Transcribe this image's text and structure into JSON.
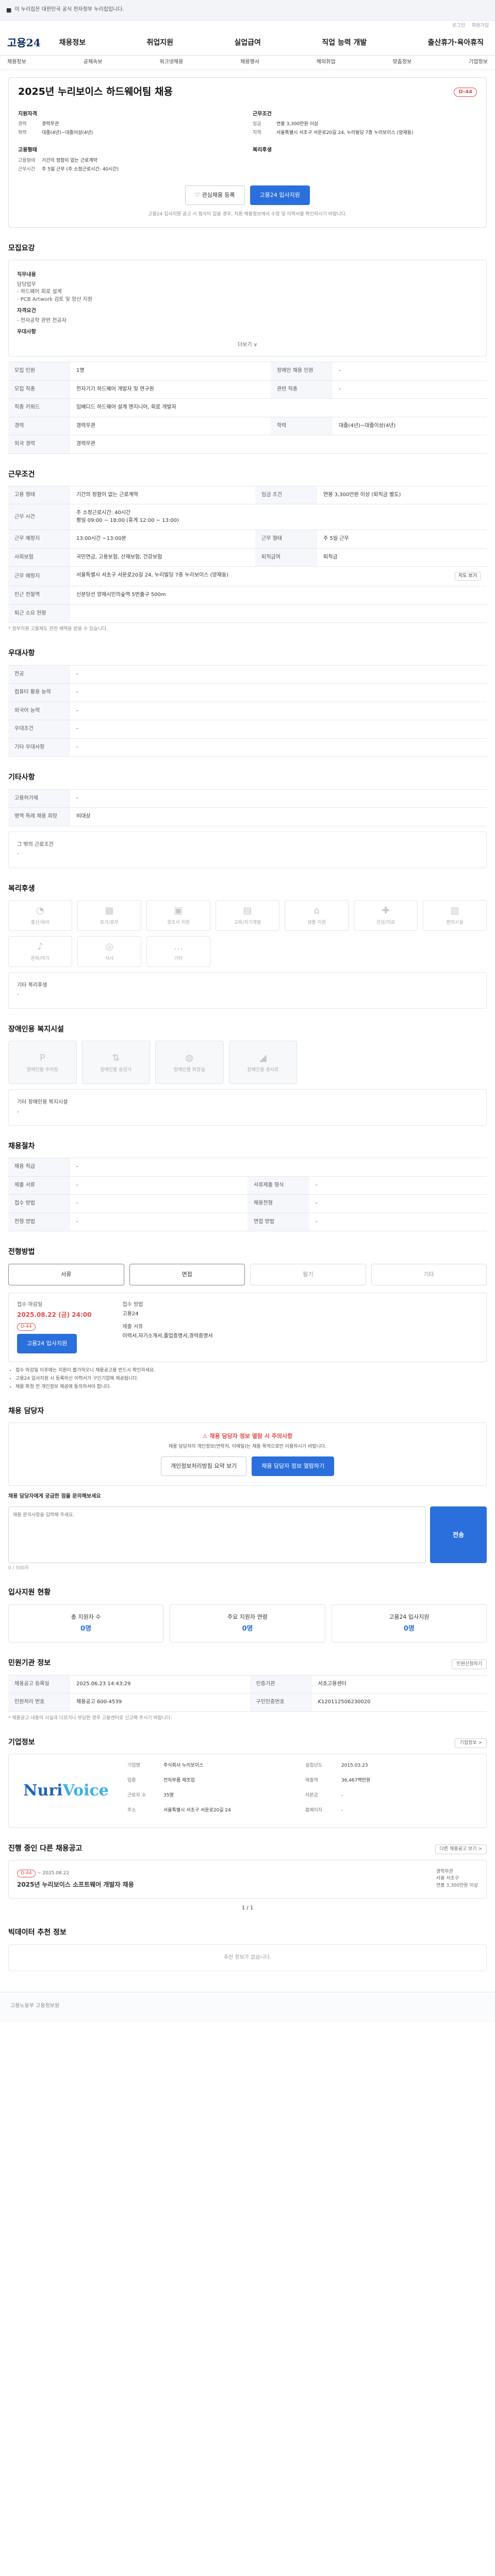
{
  "topbar": {
    "notice": "이 누리집은 대한민국 공식 전자정부 누리집입니다."
  },
  "skip": {
    "a": "로그인",
    "b": "회원가입"
  },
  "header": {
    "logo": "고용24",
    "nav": [
      "채용정보",
      "취업지원",
      "실업급여",
      "직업 능력 개발",
      "출산휴가·육아휴직"
    ]
  },
  "subnav": [
    "채용정보",
    "공채속보",
    "워크넷채용",
    "채용행사",
    "해외취업",
    "맞춤정보",
    "기업정보"
  ],
  "headline": {
    "title": "2025년 누리보이스 하드웨어팀 채용",
    "dday": "D-44",
    "company_h": "지원자격",
    "career_k": "경력",
    "career_v": "경력무관",
    "edu_k": "학력",
    "edu_v": "대졸(4년)~대졸이상(4년)",
    "cond_h": "근무조건",
    "pay_k": "임금",
    "pay_v": "연봉 3,300만원 이상",
    "region_k": "지역",
    "region_v": "서울특별시 서초구 서운로20길 24, 누리빌딩 7층 누리보이스 (양재동)",
    "type_h": "고용형태",
    "type_k": "고용형태",
    "type_v": "기간의 정함이 없는 근로계약",
    "time_k": "근무시간",
    "time_v": "주 5일 근무 (주 소정근로시간: 40시간)",
    "welfare_h": "복리후생",
    "scrap_btn": "관심채용 등록",
    "apply_btn": "고용24 입사지원",
    "note": "고용24 입사지원 공고 시 첨삭이 없을 경우, 지원 채용정보에서 수정 및 이력서를 확인하시기 바랍니다."
  },
  "detail": {
    "title": "모집요강",
    "job_label": "직무내용",
    "job_text": "담당업무\n- 하드웨어 회로 설계\n- PCB Artwork 검토 및 양산 지원",
    "req_label": "자격요건",
    "req_text": "- 전자공학 관련 전공자",
    "pref_label": "우대사항",
    "more": "더보기 ∨"
  },
  "info_rows": [
    {
      "k": "모집 인원",
      "v": "1명",
      "k2": "장애인 채용 인원",
      "v2": "-"
    },
    {
      "k": "모집 직종",
      "v": "전자기기 하드웨어 개발자 및 연구원",
      "k2": "관련 직종",
      "v2": "-"
    },
    {
      "k": "직종 키워드",
      "v": "임베디드 하드웨어 설계 엔지니어, 회로 개발자",
      "k2": "",
      "v2": ""
    },
    {
      "k": "경력",
      "v": "경력무관",
      "k2": "학력",
      "v2": "대졸(4년)~대졸이상(4년)"
    },
    {
      "k": "외국 경력",
      "v": "경력무관",
      "k2": "",
      "v2": ""
    }
  ],
  "cond": {
    "title": "근무조건",
    "rows": [
      {
        "k": "고용 형태",
        "v": "기간의 정함이 없는 근로계약",
        "k2": "임금 조건",
        "v2": "연봉 3,300만원 이상 (퇴직금 별도)"
      },
      {
        "k": "근무 시간",
        "v": "주 소정근로시간: 40시간\n평일 09:00 ~ 18:00 (휴게 12:00 ~ 13:00)",
        "k2": "",
        "v2": ""
      },
      {
        "k": "근무 예정지",
        "v": "13:00시간 ~13:00분",
        "k2": "근무 형태",
        "v2": "주 5일 근무"
      },
      {
        "k": "사회보험",
        "v": "국민연금, 고용보험, 산재보험, 건강보험",
        "k2": "퇴직급여",
        "v2": "퇴직금"
      },
      {
        "k": "근무 예정지",
        "v": "서울특별시 서초구 서운로20길 24, 누리빌딩 7층 누리보이스 (양재동)",
        "k2": "",
        "v2": ""
      },
      {
        "k": "인근 전철역",
        "v": "신분당선 양재시민의숲역 5번출구 500m",
        "k2": "",
        "v2": ""
      },
      {
        "k": "퇴근 소요 현황",
        "v": "",
        "k2": "",
        "v2": ""
      }
    ],
    "map_btn": "지도 보기",
    "footnote": "* 정부지원 고용제도 관련 혜택을 받을 수 있습니다."
  },
  "pref": {
    "title": "우대사항",
    "rows": [
      {
        "k": "전공",
        "v": "-"
      },
      {
        "k": "컴퓨터 활용 능력",
        "v": "-"
      },
      {
        "k": "외국어 능력",
        "v": "-"
      },
      {
        "k": "우대조건",
        "v": "-"
      },
      {
        "k": "기타 우대사항",
        "v": "-"
      }
    ]
  },
  "etc": {
    "title": "기타사항",
    "rows": [
      {
        "k": "고용허가제",
        "v": "-"
      },
      {
        "k": "병역 특례 채용 희망",
        "v": "비대상"
      }
    ],
    "extra_label": "그 밖의 근로조건",
    "extra_val": "-"
  },
  "welfare": {
    "title": "복리후생",
    "icons": [
      "출산/육아",
      "휴가/휴무",
      "경조사 지원",
      "교육/자기계발",
      "생활 지원",
      "건강/의료",
      "편의시설",
      "문화/여가",
      "식사",
      "기타"
    ],
    "etc_label": "기타 복리후생",
    "etc_val": "-"
  },
  "disabled": {
    "title": "장애인용 복지시설",
    "icons": [
      "장애인용 주차장",
      "장애인용 승강기",
      "장애인용 화장실",
      "장애인용 경사로"
    ],
    "etc_label": "기타 장애인용 복지시설",
    "etc_val": "-"
  },
  "selection": {
    "title": "채용절차",
    "rows": [
      {
        "k": "채용 직급",
        "v": "-"
      },
      {
        "k": "제출 서류",
        "v": "-",
        "k2": "서류제출 형식",
        "v2": "-"
      },
      {
        "k": "접수 방법",
        "v": "-",
        "k2": "채용전형",
        "v2": "-"
      },
      {
        "k": "전형 방법",
        "v": "-",
        "k2": "면접 방법",
        "v2": "-"
      }
    ]
  },
  "apply": {
    "title": "전형방법",
    "tabs": [
      "서류",
      "면접",
      "필기",
      "기타"
    ],
    "period_label": "접수 마감일",
    "period_val": "2025.08.22 (금) 24:00",
    "dday": "D-44",
    "btn": "고용24 입사지원",
    "method_label": "접수 방법",
    "method_val": "고용24",
    "docs_label": "제출 서류",
    "docs_val": "이력서,자기소개서,졸업증명서,경력증명서",
    "bullets": [
      "접수 마감일 이후에는 지원이 불가하오니 채용공고를 반드시 확인하세요.",
      "고용24 입사지원 시 등록하신 이력서가 구인기업에 제공됩니다.",
      "채용 확정 전 개인정보 제공에 동의하셔야 합니다."
    ]
  },
  "contact": {
    "title": "채용 담당자",
    "warn": "채용 담당자 정보 열람 시 주의사항",
    "warn_text": "채용 담당자의 개인정보(연락처, 이메일)는 채용 목적으로만 이용하시기 바랍니다.",
    "btn1": "개인정보처리방침 요약 보기",
    "btn2": "채용 담당자 정보 열람하기",
    "q_label": "채용 담당자에게 궁금한 점을 문의해보세요",
    "q_placeholder": "채용 문의사항을 입력해 주세요.",
    "q_btn": "전송",
    "q_count": "0 / 500자"
  },
  "stats": {
    "title": "입사지원 현황",
    "items": [
      {
        "label": "총 지원자 수",
        "n": "0명"
      },
      {
        "label": "주요 지원자 연령",
        "n": "0명"
      },
      {
        "label": "고용24 입사지원",
        "n": "0명"
      }
    ]
  },
  "agency": {
    "title": "민원기관 정보",
    "btn": "민원신청하기",
    "rows": [
      {
        "k": "채용공고 등록일",
        "v": "2025.06.23 14:43:29",
        "k2": "인증기관",
        "v2": "서초고용센터"
      },
      {
        "k": "민원처리 번호",
        "v": "채용공고 600-4539",
        "k2": "구인인증번호",
        "v2": "K120112506230020"
      }
    ],
    "note": "* 채용공고 내용이 사실과 다르거나 부당한 경우 고용센터로 신고해 주시기 바랍니다."
  },
  "company": {
    "title": "기업정보",
    "more": "기업정보 >",
    "logo_a": "Nuri",
    "logo_b": "Voice",
    "fields": [
      {
        "k": "기업명",
        "v": "주식회사 누리보이스"
      },
      {
        "k": "설립년도",
        "v": "2015.03.23"
      },
      {
        "k": "업종",
        "v": "전자부품 제조업"
      },
      {
        "k": "매출액",
        "v": "36,467백만원"
      },
      {
        "k": "근로자 수",
        "v": "35명"
      },
      {
        "k": "자본금",
        "v": "-"
      },
      {
        "k": "주소",
        "v": "서울특별시 서초구 서운로20길 24"
      },
      {
        "k": "홈페이지",
        "v": "-"
      }
    ]
  },
  "related": {
    "title": "진행 중인 다른 채용공고",
    "more": "다른 채용공고 보기 >",
    "job_dday": "D-44",
    "job_period": "~ 2025.08.22",
    "job_title": "2025년 누리보이스 소프트웨어 개발자 채용",
    "job_meta1": "경력무관",
    "job_meta2": "서울 서초구",
    "job_meta3": "연봉 3,300만원 이상",
    "pager": "1 / 1"
  },
  "ai": {
    "title": "빅데이터 추천 정보",
    "empty": "추천 정보가 없습니다."
  },
  "footer": {
    "text": "고용노동부 고용정보원"
  }
}
